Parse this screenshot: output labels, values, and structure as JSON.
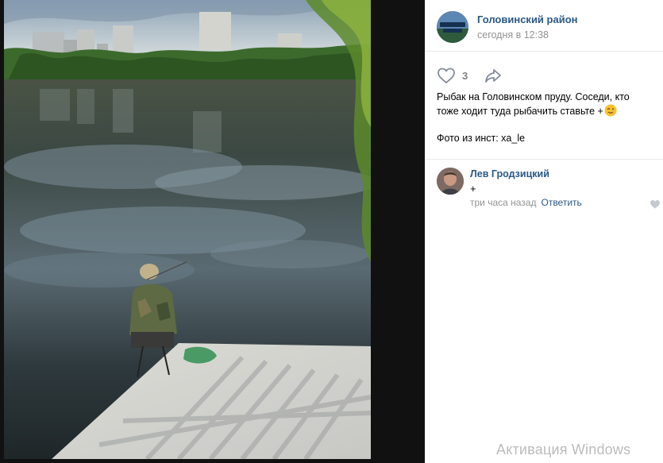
{
  "post": {
    "group_name": "Головинский район",
    "date": "сегодня в 12:38",
    "likes_count": "3",
    "text": "Рыбак на Головинском пруду. Соседи, кто тоже ходит туда рыбачить ставьте +",
    "source": "Фото из инст: xa_le"
  },
  "comment": {
    "author": "Лев Гродзицкий",
    "text": "+",
    "time": "три часа назад",
    "reply_label": "Ответить"
  },
  "overlay": {
    "activation_text": "Активация Windows"
  },
  "colors": {
    "link": "#2a5885",
    "meta": "#939393",
    "divider": "#e7e8ec",
    "backdrop": "#1d1d1d"
  },
  "icons": [
    "heart-outline-icon",
    "share-arrow-icon",
    "wink-emoji-icon",
    "small-heart-icon"
  ]
}
